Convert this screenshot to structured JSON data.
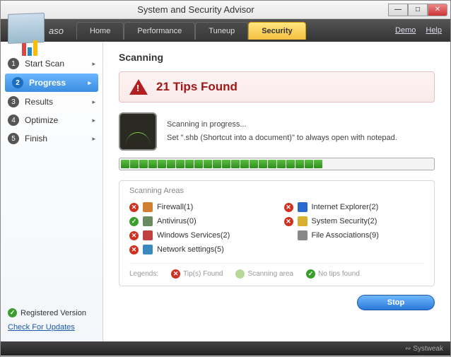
{
  "window": {
    "title": "System and Security Advisor",
    "brand": "aso",
    "tabs": [
      "Home",
      "Performance",
      "Tuneup",
      "Security"
    ],
    "active_tab": "Security",
    "links": {
      "demo": "Demo",
      "help": "Help"
    }
  },
  "sidebar": {
    "steps": [
      {
        "n": "1",
        "label": "Start Scan"
      },
      {
        "n": "2",
        "label": "Progress"
      },
      {
        "n": "3",
        "label": "Results"
      },
      {
        "n": "4",
        "label": "Optimize"
      },
      {
        "n": "5",
        "label": "Finish"
      }
    ],
    "active_index": 1,
    "registered": "Registered Version",
    "check_updates": "Check For Updates"
  },
  "main": {
    "heading": "Scanning",
    "tips_found": "21 Tips Found",
    "scan_status": "Scanning in progress...",
    "scan_detail": "Set \".shb (Shortcut into a document)\" to always open with notepad.",
    "progress_segments": 34,
    "progress_filled": 22,
    "areas_title": "Scanning Areas",
    "areas": [
      {
        "status": "bad",
        "icon": "#d08030",
        "label": "Firewall(1)"
      },
      {
        "status": "bad",
        "icon": "#2a6ad0",
        "label": "Internet Explorer(2)"
      },
      {
        "status": "good",
        "icon": "#6a8a60",
        "label": "Antivirus(0)"
      },
      {
        "status": "bad",
        "icon": "#d8b030",
        "label": "System Security(2)"
      },
      {
        "status": "bad",
        "icon": "#c04040",
        "label": "Windows Services(2)"
      },
      {
        "status": "none",
        "icon": "#888888",
        "label": "File Associations(9)"
      },
      {
        "status": "bad",
        "icon": "#3a8ac0",
        "label": "Network settings(5)"
      }
    ],
    "legends": {
      "label": "Legends:",
      "tips": "Tip(s) Found",
      "scanning": "Scanning area",
      "none": "No tips found"
    },
    "stop": "Stop"
  },
  "footer": {
    "vendor": "Systweak"
  }
}
